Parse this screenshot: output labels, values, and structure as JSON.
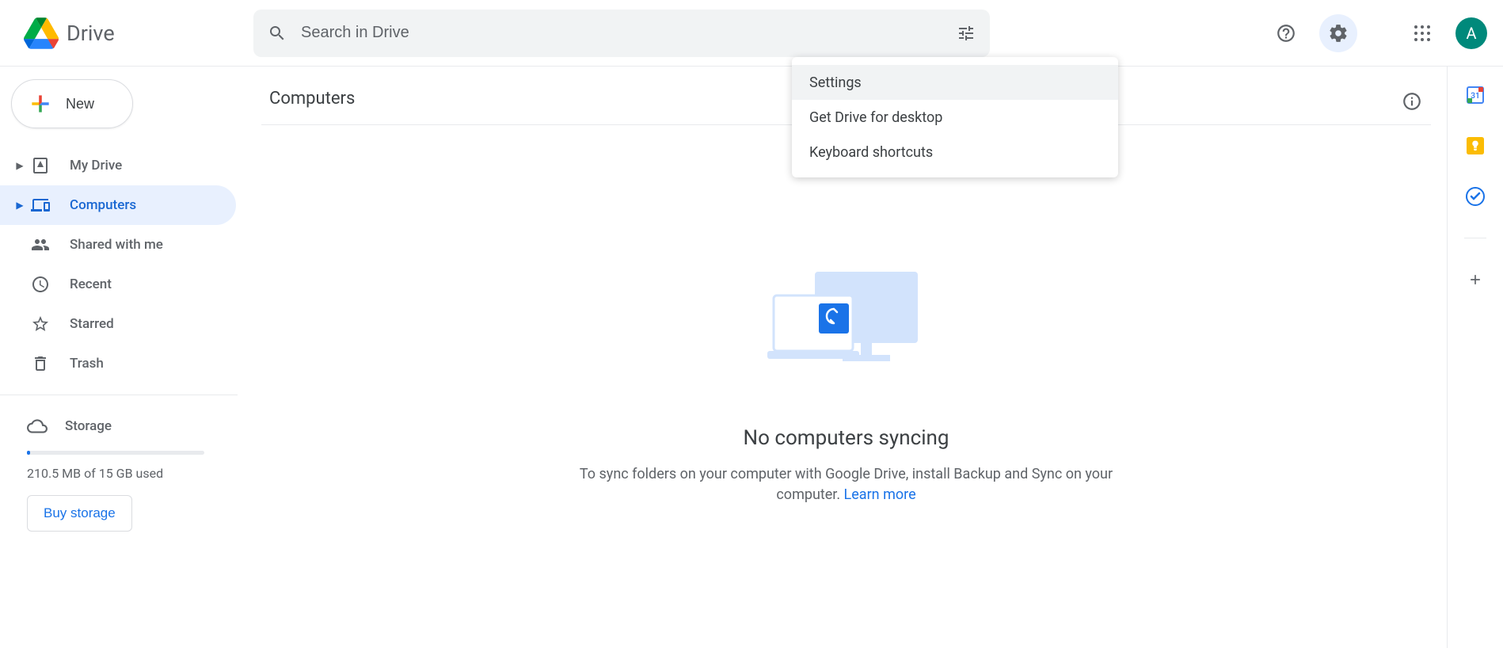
{
  "header": {
    "product_name": "Drive",
    "search_placeholder": "Search in Drive",
    "avatar_initial": "A"
  },
  "sidebar": {
    "new_label": "New",
    "items": [
      {
        "label": "My Drive"
      },
      {
        "label": "Computers"
      },
      {
        "label": "Shared with me"
      },
      {
        "label": "Recent"
      },
      {
        "label": "Starred"
      },
      {
        "label": "Trash"
      }
    ],
    "storage_label": "Storage",
    "storage_used_text": "210.5 MB of 15 GB used",
    "buy_label": "Buy storage"
  },
  "main": {
    "page_title": "Computers",
    "empty_title": "No computers syncing",
    "empty_desc_prefix": "To sync folders on your computer with Google Drive, install Backup and Sync on your computer. ",
    "learn_more": "Learn more"
  },
  "settings_menu": {
    "items": [
      "Settings",
      "Get Drive for desktop",
      "Keyboard shortcuts"
    ]
  }
}
